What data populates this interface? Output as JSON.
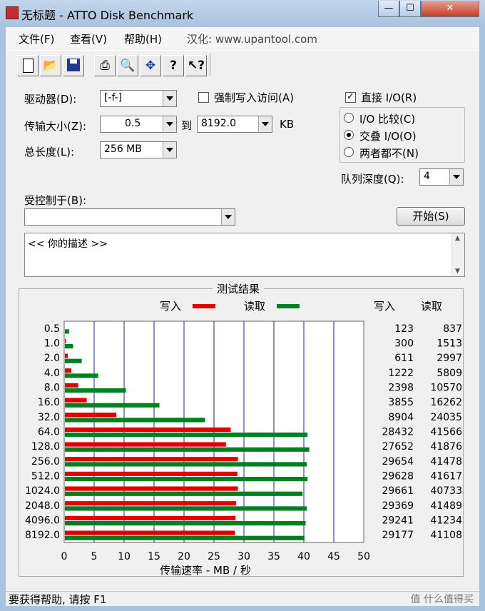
{
  "window": {
    "title": "无标题 - ATTO Disk Benchmark",
    "buttons": {
      "minimize": "—",
      "maximize": "☐",
      "close": "✕"
    }
  },
  "menu": {
    "items": [
      "文件(F)",
      "查看(V)",
      "帮助(H)",
      "汉化: www.upantool.com"
    ]
  },
  "toolbar": {
    "buttons": [
      "new-icon",
      "open-icon",
      "save-icon",
      "print-icon",
      "preview-icon",
      "move-icon",
      "help-icon",
      "context-help-icon"
    ]
  },
  "settings": {
    "drive_label": "驱动器(D):",
    "drive_value": "[-f-]",
    "force_write_label": "强制写入访问(A)",
    "force_write_checked": false,
    "direct_io_label": "直接 I/O(R)",
    "direct_io_checked": true,
    "transfer_label": "传输大小(Z):",
    "transfer_from": "0.5",
    "to_label": "到",
    "transfer_to": "8192.0",
    "kb_label": "KB",
    "total_label": "总长度(L):",
    "total_value": "256 MB",
    "io_compare_label": "I/O 比较(C)",
    "overlapped_label": "交叠 I/O(O)",
    "neither_label": "两者都不(N)",
    "selected_mode": "overlapped",
    "queue_label": "队列深度(Q):",
    "queue_value": "4",
    "controlled_label": "受控制于(B):",
    "controlled_value": "",
    "start_label": "开始(S)",
    "description": "<< 你的描述 >>"
  },
  "results": {
    "title": "测试结果",
    "write_label": "写入",
    "read_label": "读取",
    "col_write": "写入",
    "col_read": "读取",
    "x_axis_label": "传输速率 - MB / 秒",
    "write_color": "#e00000",
    "read_color": "#008020"
  },
  "chart_data": {
    "type": "bar",
    "orientation": "horizontal",
    "categories": [
      "0.5",
      "1.0",
      "2.0",
      "4.0",
      "8.0",
      "16.0",
      "32.0",
      "64.0",
      "128.0",
      "256.0",
      "512.0",
      "1024.0",
      "2048.0",
      "4096.0",
      "8192.0"
    ],
    "series": [
      {
        "name": "写入",
        "values": [
          0.12,
          0.29,
          0.6,
          1.19,
          2.34,
          3.76,
          8.7,
          27.8,
          27.0,
          29.0,
          28.9,
          29.0,
          28.7,
          28.6,
          28.5
        ],
        "table_values": [
          "123",
          "300",
          "611",
          "1222",
          "2398",
          "3855",
          "8904",
          "28432",
          "27652",
          "29654",
          "29628",
          "29661",
          "29369",
          "29241",
          "29177"
        ]
      },
      {
        "name": "读取",
        "values": [
          0.82,
          1.48,
          2.93,
          5.67,
          10.3,
          15.9,
          23.5,
          40.6,
          40.9,
          40.5,
          40.6,
          39.8,
          40.5,
          40.3,
          40.1
        ],
        "table_values": [
          "837",
          "1513",
          "2997",
          "5809",
          "10570",
          "16262",
          "24035",
          "41566",
          "41876",
          "41478",
          "41617",
          "40733",
          "41489",
          "41234",
          "41108"
        ]
      }
    ],
    "xticks": [
      "0",
      "5",
      "10",
      "15",
      "20",
      "25",
      "30",
      "35",
      "40",
      "45",
      "50"
    ],
    "xlim": [
      0,
      50
    ],
    "xlabel": "传输速率 - MB / 秒",
    "grid": true,
    "legend": "top-center"
  },
  "status": {
    "text": "要获得帮助, 请按 F1"
  },
  "watermark": {
    "text": "值 什么值得买"
  }
}
